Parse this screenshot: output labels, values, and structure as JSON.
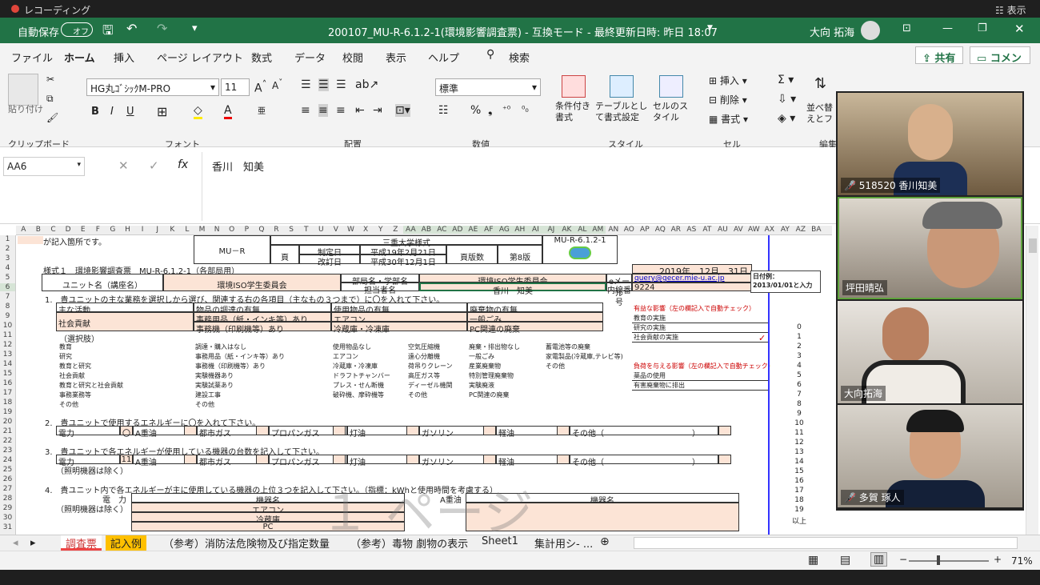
{
  "recording": {
    "label": "レコーディング",
    "right": "表示"
  },
  "title": {
    "autosave": "自動保存",
    "toggle": "オフ",
    "filename": "200107_MU-R-6.1.2-1(環境影響調査票) - 互換モード - 最終更新日時: 昨日 18:07",
    "user": "大向 拓海"
  },
  "menu": [
    "ファイル",
    "ホーム",
    "挿入",
    "ページ レイアウト",
    "数式",
    "データ",
    "校閲",
    "表示",
    "ヘルプ"
  ],
  "search": "検索",
  "share": "共有",
  "comment": "コメント",
  "ribbon": {
    "paste": "貼り付け",
    "clipboard": "クリップボード",
    "font_name": "HG丸ｺﾞｼｯｸM-PRO",
    "font_size": "11",
    "font": "フォント",
    "align": "配置",
    "number_format": "標準",
    "number": "数値",
    "cond": "条件付き書式",
    "table": "テーブルとして書式設定",
    "cellstyle": "セルのスタイル",
    "style": "スタイル",
    "insert": "挿入",
    "delete": "削除",
    "format": "書式",
    "cells": "セル",
    "sort": "並べ替えとフィルター",
    "edit": "編集"
  },
  "formula": {
    "namebox": "AA6",
    "fx": "fx",
    "value": "香川　知美"
  },
  "columns": [
    "A",
    "B",
    "C",
    "D",
    "E",
    "F",
    "G",
    "H",
    "I",
    "J",
    "K",
    "L",
    "M",
    "N",
    "O",
    "P",
    "Q",
    "R",
    "S",
    "T",
    "U",
    "V",
    "W",
    "X",
    "Y",
    "Z",
    "AA",
    "AB",
    "AC",
    "AD",
    "AE",
    "AF",
    "AG",
    "AH",
    "AI",
    "AJ",
    "AK",
    "AL",
    "AM",
    "AN",
    "AO",
    "AP",
    "AQ",
    "AR",
    "AS",
    "AT",
    "AU",
    "AV",
    "AW",
    "AX",
    "AY",
    "AZ",
    "BA"
  ],
  "rows": [
    "1",
    "2",
    "3",
    "4",
    "5",
    "6",
    "7",
    "8",
    "9",
    "10",
    "11",
    "12",
    "13",
    "14",
    "15",
    "16",
    "17",
    "18",
    "19",
    "20",
    "21",
    "22",
    "23",
    "24",
    "25",
    "26",
    "27",
    "28",
    "29",
    "30",
    "31"
  ],
  "sheet": {
    "r1": "が記入箇所です。",
    "mur": "MU－R",
    "univ": "三重大学様式",
    "code": "MU-R-6.1.2-1",
    "page": "頁",
    "created_l": "制定日",
    "created": "平成19年2月21日",
    "revised_l": "改訂日",
    "revised": "平成30年12月1日",
    "ver_l": "頁版数",
    "ver": "第8版",
    "form": "様式１　環境影響調査票　MU-R-6.1.2-1（各部局用）",
    "date": "2019年　12月　31日",
    "note_t": "日付例：",
    "note_v": "2013/01/01と入力",
    "unit_l": "ユニット名（講座名）",
    "unit": "環境ISO学生委員会",
    "dept_l": "部局名・学部名",
    "dept": "環境ISO学生委員会",
    "mail_l": "eメール",
    "mail": "query@gecer.mie-u.ac.jp",
    "person_l": "担当者名",
    "person": "香川　知美",
    "ext_l": "内線番号",
    "ext": "9224",
    "q1": "1.　貴ユニットの主な業務を選択しから選び、関連する右の各項目（主なもの３つまで）に〇を入れて下さい。",
    "h_main": "主な活動",
    "h_buy": "物品の調達の有無",
    "h_use": "使用物品の有無",
    "h_waste": "廃棄物の有無",
    "v_main": "社会貢献",
    "v_buy1": "事務用品（紙・インキ等）あり",
    "v_buy2": "事務機（印刷機等）あり",
    "v_use1": "エアコン",
    "v_use2": "冷蔵庫・冷凍庫",
    "v_waste1": "一般ごみ",
    "v_waste2": "PC関連の廃棄",
    "choices": "（選択肢）",
    "c_main": [
      "教育",
      "研究",
      "教育と研究",
      "社会貢献",
      "教育と研究と社会貢献",
      "事務業務等",
      "その他"
    ],
    "c_buy": [
      "調達・購入はなし",
      "事務用品（紙・インキ等）あり",
      "事務機（印刷機等）あり",
      "実験機器あり",
      "実験試薬あり",
      "建設工事",
      "その他"
    ],
    "c_use1": [
      "使用物品なし",
      "エアコン",
      "冷蔵庫・冷凍庫",
      "ドラフトチャンバー",
      "プレス・せん断機",
      "破砕機、摩砕機等"
    ],
    "c_use2": [
      "空気圧縮機",
      "遠心分離機",
      "荷吊りクレーン",
      "高圧ガス等",
      "ディーゼル機関",
      "その他"
    ],
    "c_waste1": [
      "廃棄・排出物なし",
      "一般ごみ",
      "産業廃棄物",
      "特別管理廃棄物",
      "実験廃液",
      "PC関連の廃棄"
    ],
    "c_waste2": [
      "蓄電池等の廃棄",
      "家電製品(冷蔵庫,テレビ等)",
      "その他"
    ],
    "good_h": "有益な影響",
    "good_hs": "（左の欄記入で自動チェック）",
    "good": [
      "教育の実施",
      "研究の実施",
      "社会貢献の実施"
    ],
    "check": "✓",
    "bad_h": "負荷を与える影響",
    "bad_hs": "（左の欄記入で自動チェック）",
    "bad": [
      "薬品の使用",
      "有害廃棄物に排出"
    ],
    "nums": [
      "0",
      "1",
      "2",
      "3",
      "4",
      "5",
      "6",
      "7",
      "8",
      "9",
      "10",
      "11",
      "12",
      "13",
      "14",
      "15",
      "16",
      "17",
      "18",
      "19",
      "以上"
    ],
    "q2": "2.　貴ユニットで使用するエネルギーに〇を入れて下さい。",
    "e_labels": [
      "電力",
      "A重油",
      "都市ガス",
      "プロパンガス",
      "灯油",
      "ガソリン",
      "軽油",
      "その他（　　　　　　　　　　　）"
    ],
    "e_mark": "〇",
    "q3": "3.　貴ユニットで各エネルギーが使用している機器の台数を記入して下さい。",
    "e_count": "11",
    "q3n": "（照明機器は除く）",
    "q4": "4.　貴ユニット内で各エネルギーが主に使用している機器の上位３つを記入して下さい。（指標：kWhと使用時間を考慮する）",
    "q4_power": "電　力",
    "q4_note": "（照明機器は除く）",
    "q4_dev": "機器名",
    "q4_oil": "A重油",
    "q4_dev2": "機器名",
    "q4_items": [
      "エアコン",
      "冷蔵庫",
      "PC"
    ],
    "watermark": "１ ページ"
  },
  "tabs": [
    "調査票",
    "記入例",
    "（参考）消防法危険物及び指定数量",
    "（参考）毒物 劇物の表示",
    "Sheet1",
    "集計用シ- ..."
  ],
  "zoom": "71%",
  "participants": [
    {
      "name": "518520 香川知美",
      "muted": true
    },
    {
      "name": "坪田晴弘",
      "muted": false
    },
    {
      "name": "大向拓海",
      "muted": false
    },
    {
      "name": "多賀 琢人",
      "muted": true
    }
  ]
}
